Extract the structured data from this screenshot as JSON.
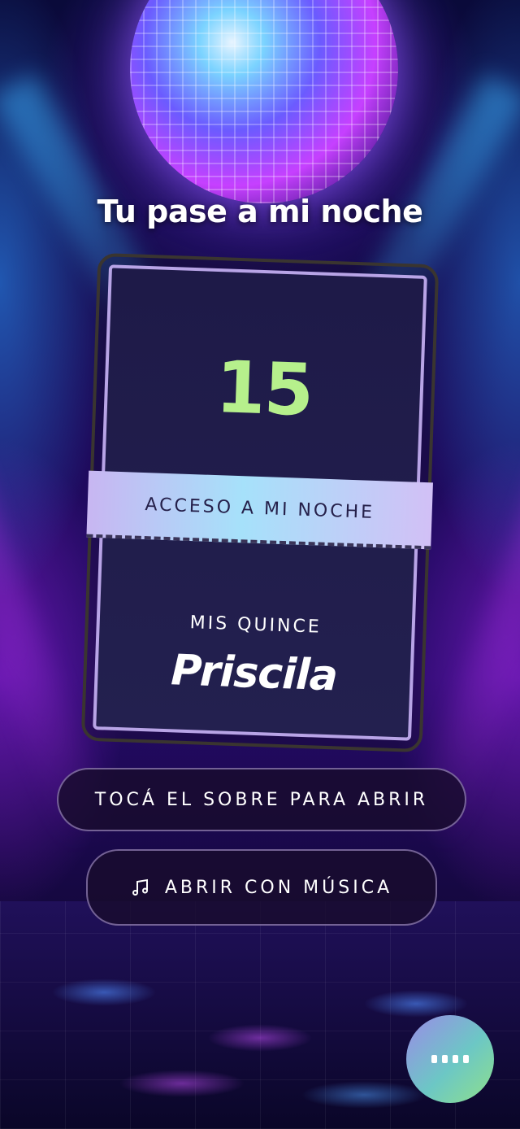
{
  "title": "Tu pase a mi noche",
  "ticket": {
    "number": "15",
    "band_text": "ACCESO A MI NOCHE",
    "subtitle": "MIS QUINCE",
    "name": "Priscila"
  },
  "buttons": {
    "open_label": "TOCÁ EL SOBRE PARA ABRIR",
    "music_label": "ABRIR CON MÚSICA"
  },
  "icons": {
    "music": "music-note-icon",
    "menu": "more-dots-icon"
  },
  "colors": {
    "number_green": "#b6f08c",
    "band_gradient_start": "#c8b6f2",
    "band_gradient_mid": "#a6e1fa",
    "ticket_bg": "#1e1a48"
  }
}
